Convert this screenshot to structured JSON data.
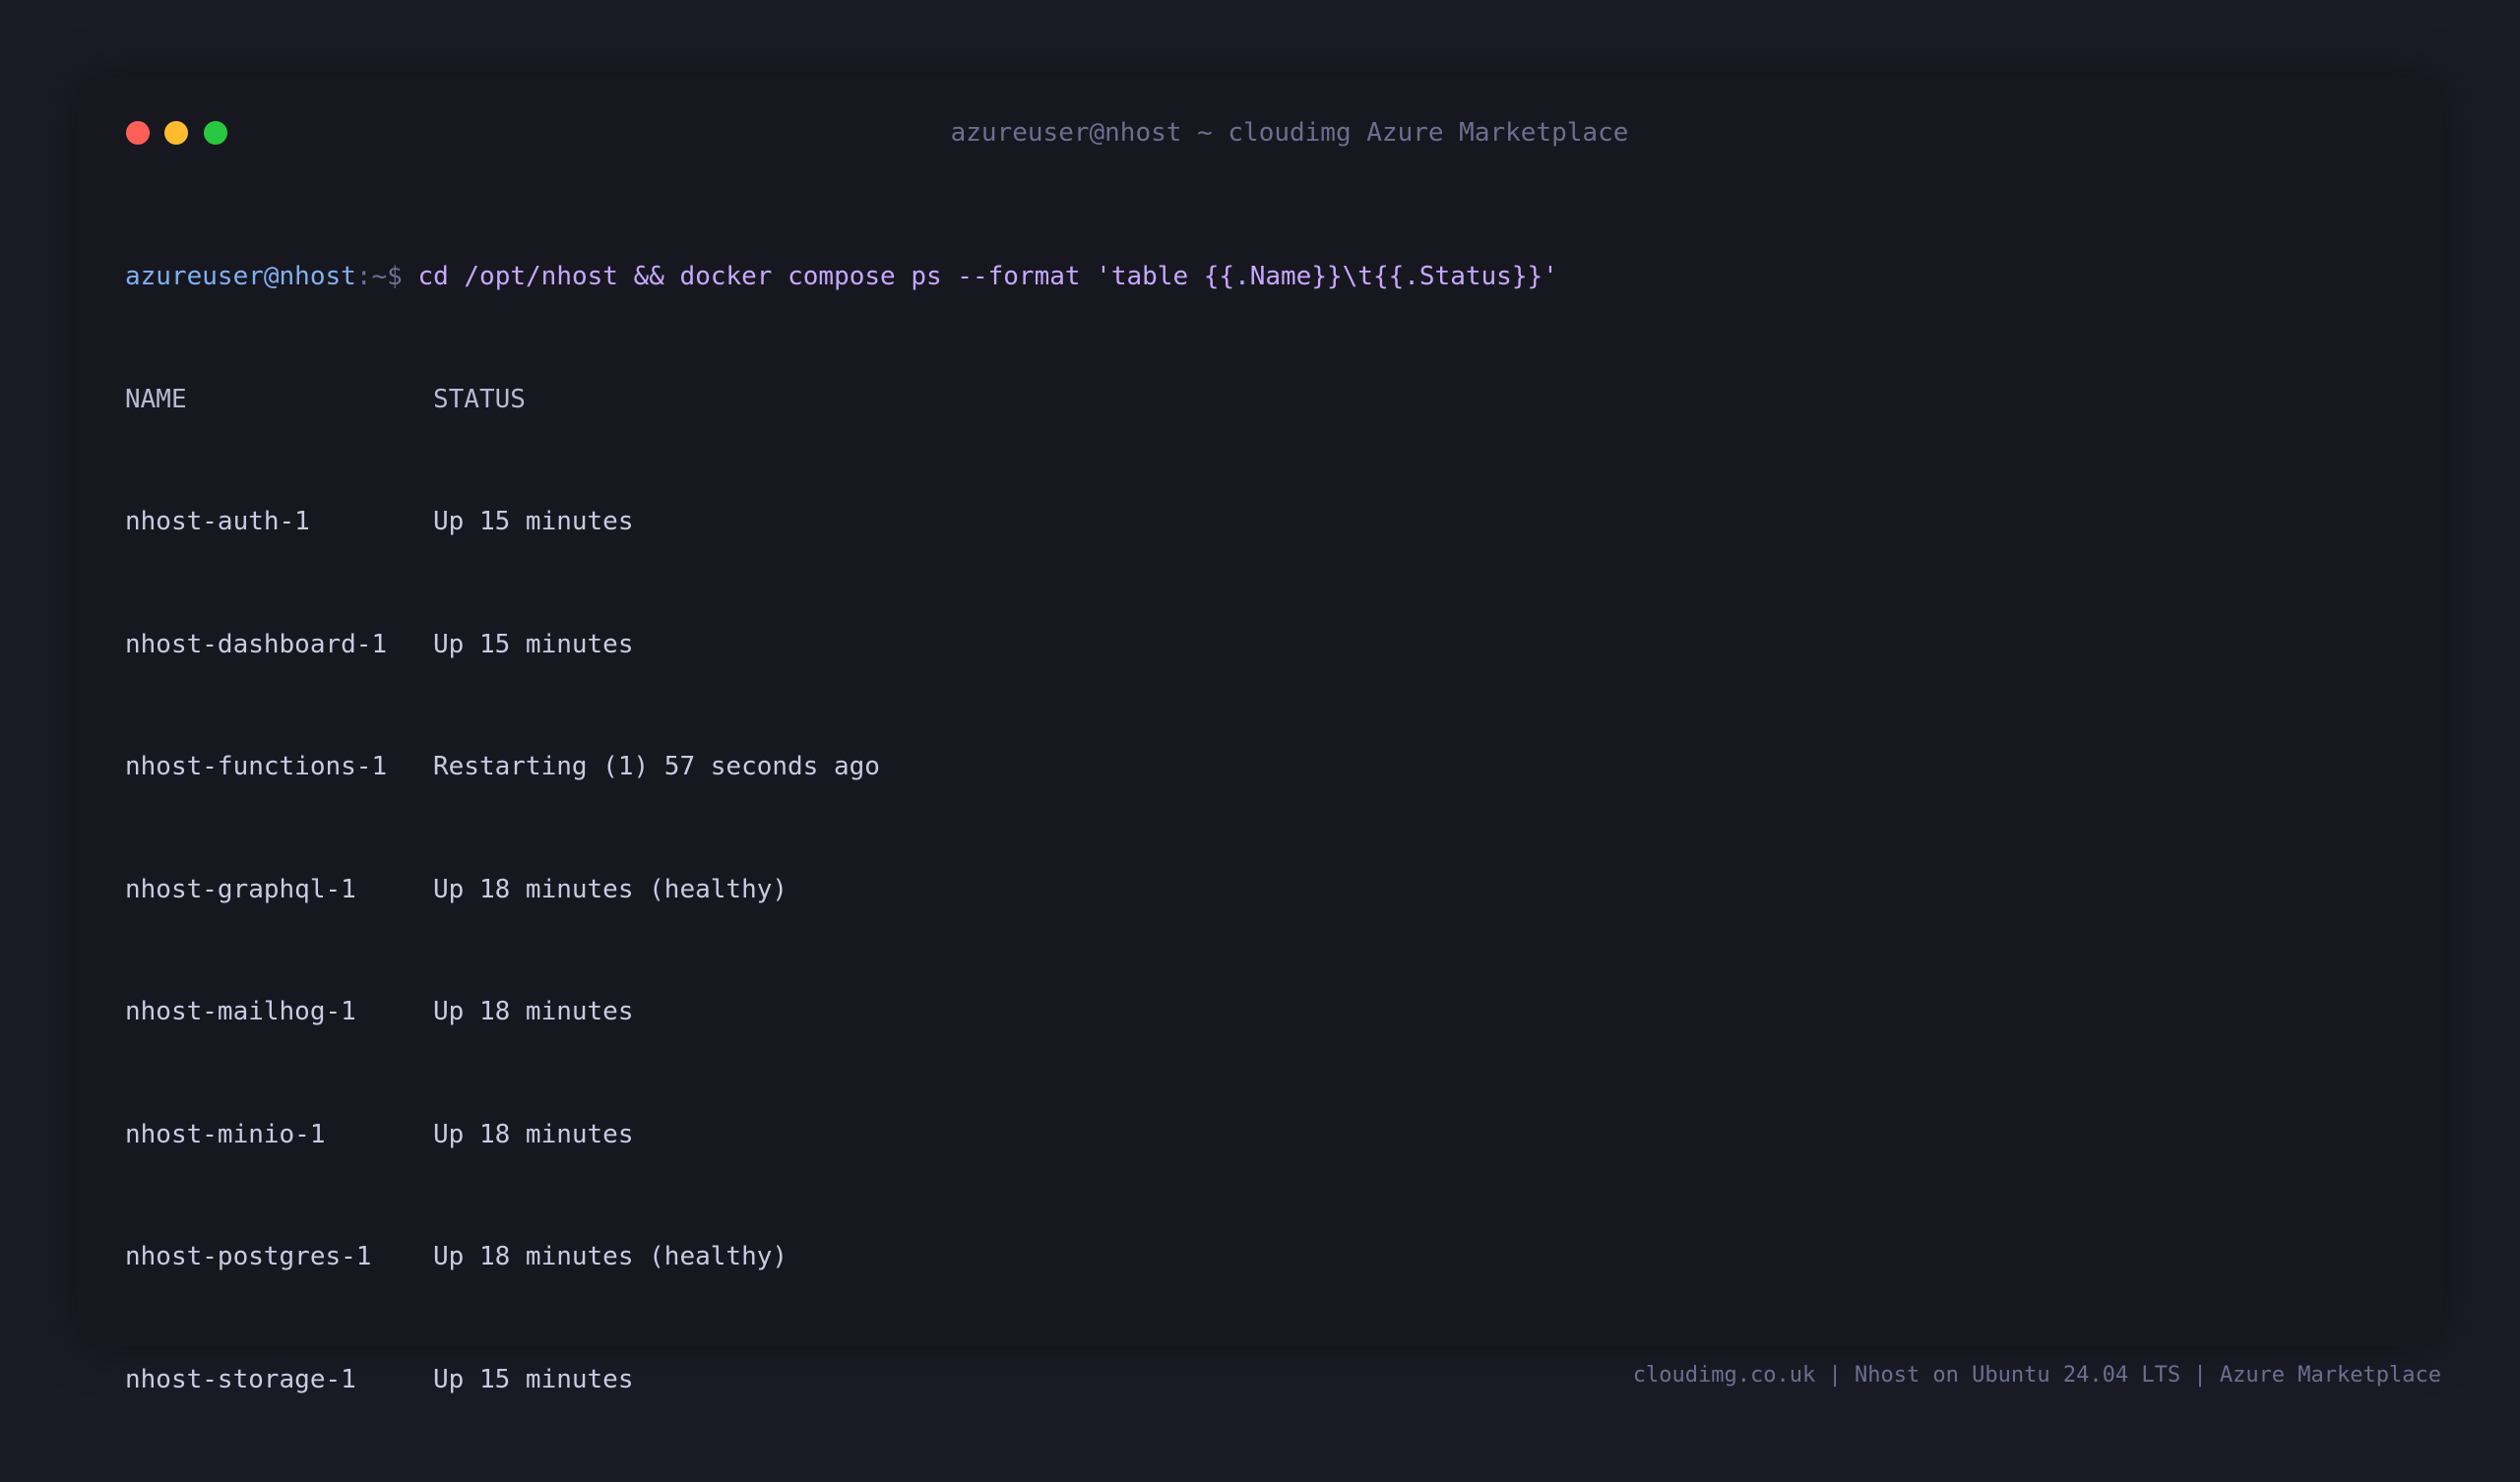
{
  "window": {
    "title": "azureuser@nhost ~ cloudimg Azure Marketplace"
  },
  "terminal": {
    "prompt_user": "azureuser@nhost",
    "prompt_path": ":~$ ",
    "command": "cd /opt/nhost && docker compose ps --format 'table {{.Name}}\\t{{.Status}}'",
    "headers": {
      "name": "NAME",
      "status": "STATUS"
    },
    "rows": [
      {
        "name": "nhost-auth-1",
        "status": "Up 15 minutes"
      },
      {
        "name": "nhost-dashboard-1",
        "status": "Up 15 minutes"
      },
      {
        "name": "nhost-functions-1",
        "status": "Restarting (1) 57 seconds ago"
      },
      {
        "name": "nhost-graphql-1",
        "status": "Up 18 minutes (healthy)"
      },
      {
        "name": "nhost-mailhog-1",
        "status": "Up 18 minutes"
      },
      {
        "name": "nhost-minio-1",
        "status": "Up 18 minutes"
      },
      {
        "name": "nhost-postgres-1",
        "status": "Up 18 minutes (healthy)"
      },
      {
        "name": "nhost-storage-1",
        "status": "Up 15 minutes"
      }
    ]
  },
  "footer": {
    "text": "cloudimg.co.uk | Nhost on Ubuntu 24.04 LTS | Azure Marketplace"
  },
  "colors": {
    "background": "#1b1b26",
    "terminal_bg": "#171720",
    "prompt": "#7fb0f0",
    "command": "#c6a8ff",
    "text": "#c9cbe0",
    "muted": "#6c6f8f"
  }
}
